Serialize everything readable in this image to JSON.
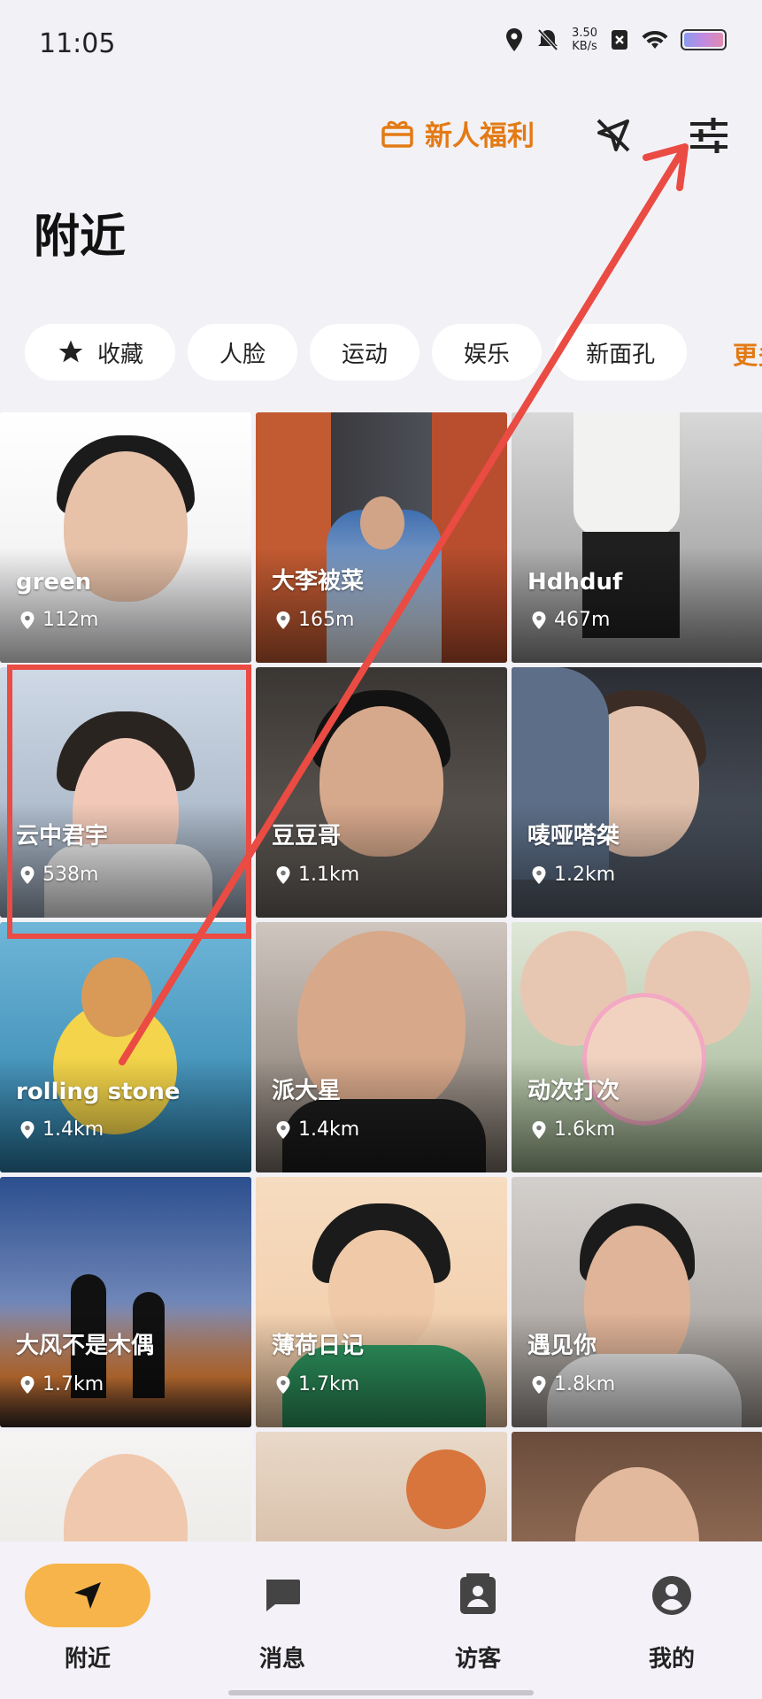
{
  "status_bar": {
    "time": "11:05",
    "speed_value": "3.50",
    "speed_unit": "KB/s"
  },
  "header": {
    "promo_label": "新人福利",
    "page_title": "附近"
  },
  "filters": {
    "chips": [
      {
        "label": "收藏",
        "icon": "star-icon"
      },
      {
        "label": "人脸"
      },
      {
        "label": "运动"
      },
      {
        "label": "娱乐"
      },
      {
        "label": "新面孔"
      }
    ],
    "more_label": "更多"
  },
  "users": [
    {
      "name": "green",
      "distance": "112m"
    },
    {
      "name": "大李被菜",
      "distance": "165m"
    },
    {
      "name": "Hdhduf",
      "distance": "467m"
    },
    {
      "name": "云中君宇",
      "distance": "538m"
    },
    {
      "name": "豆豆哥",
      "distance": "1.1km"
    },
    {
      "name": "唛哑嗒桀",
      "distance": "1.2km"
    },
    {
      "name": "rolling stone",
      "distance": "1.4km"
    },
    {
      "name": "派大星",
      "distance": "1.4km"
    },
    {
      "name": "动次打次",
      "distance": "1.6km"
    },
    {
      "name": "大风不是木偶",
      "distance": "1.7km"
    },
    {
      "name": "薄荷日记",
      "distance": "1.7km"
    },
    {
      "name": "遇见你",
      "distance": "1.8km"
    }
  ],
  "bottom_nav": [
    {
      "label": "附近",
      "icon": "location-arrow-icon",
      "active": true
    },
    {
      "label": "消息",
      "icon": "chat-icon"
    },
    {
      "label": "访客",
      "icon": "contact-card-icon"
    },
    {
      "label": "我的",
      "icon": "profile-icon"
    }
  ],
  "colors": {
    "accent": "#e37a14",
    "active_pill": "#f6b44a",
    "annotation": "#ea4b43"
  }
}
